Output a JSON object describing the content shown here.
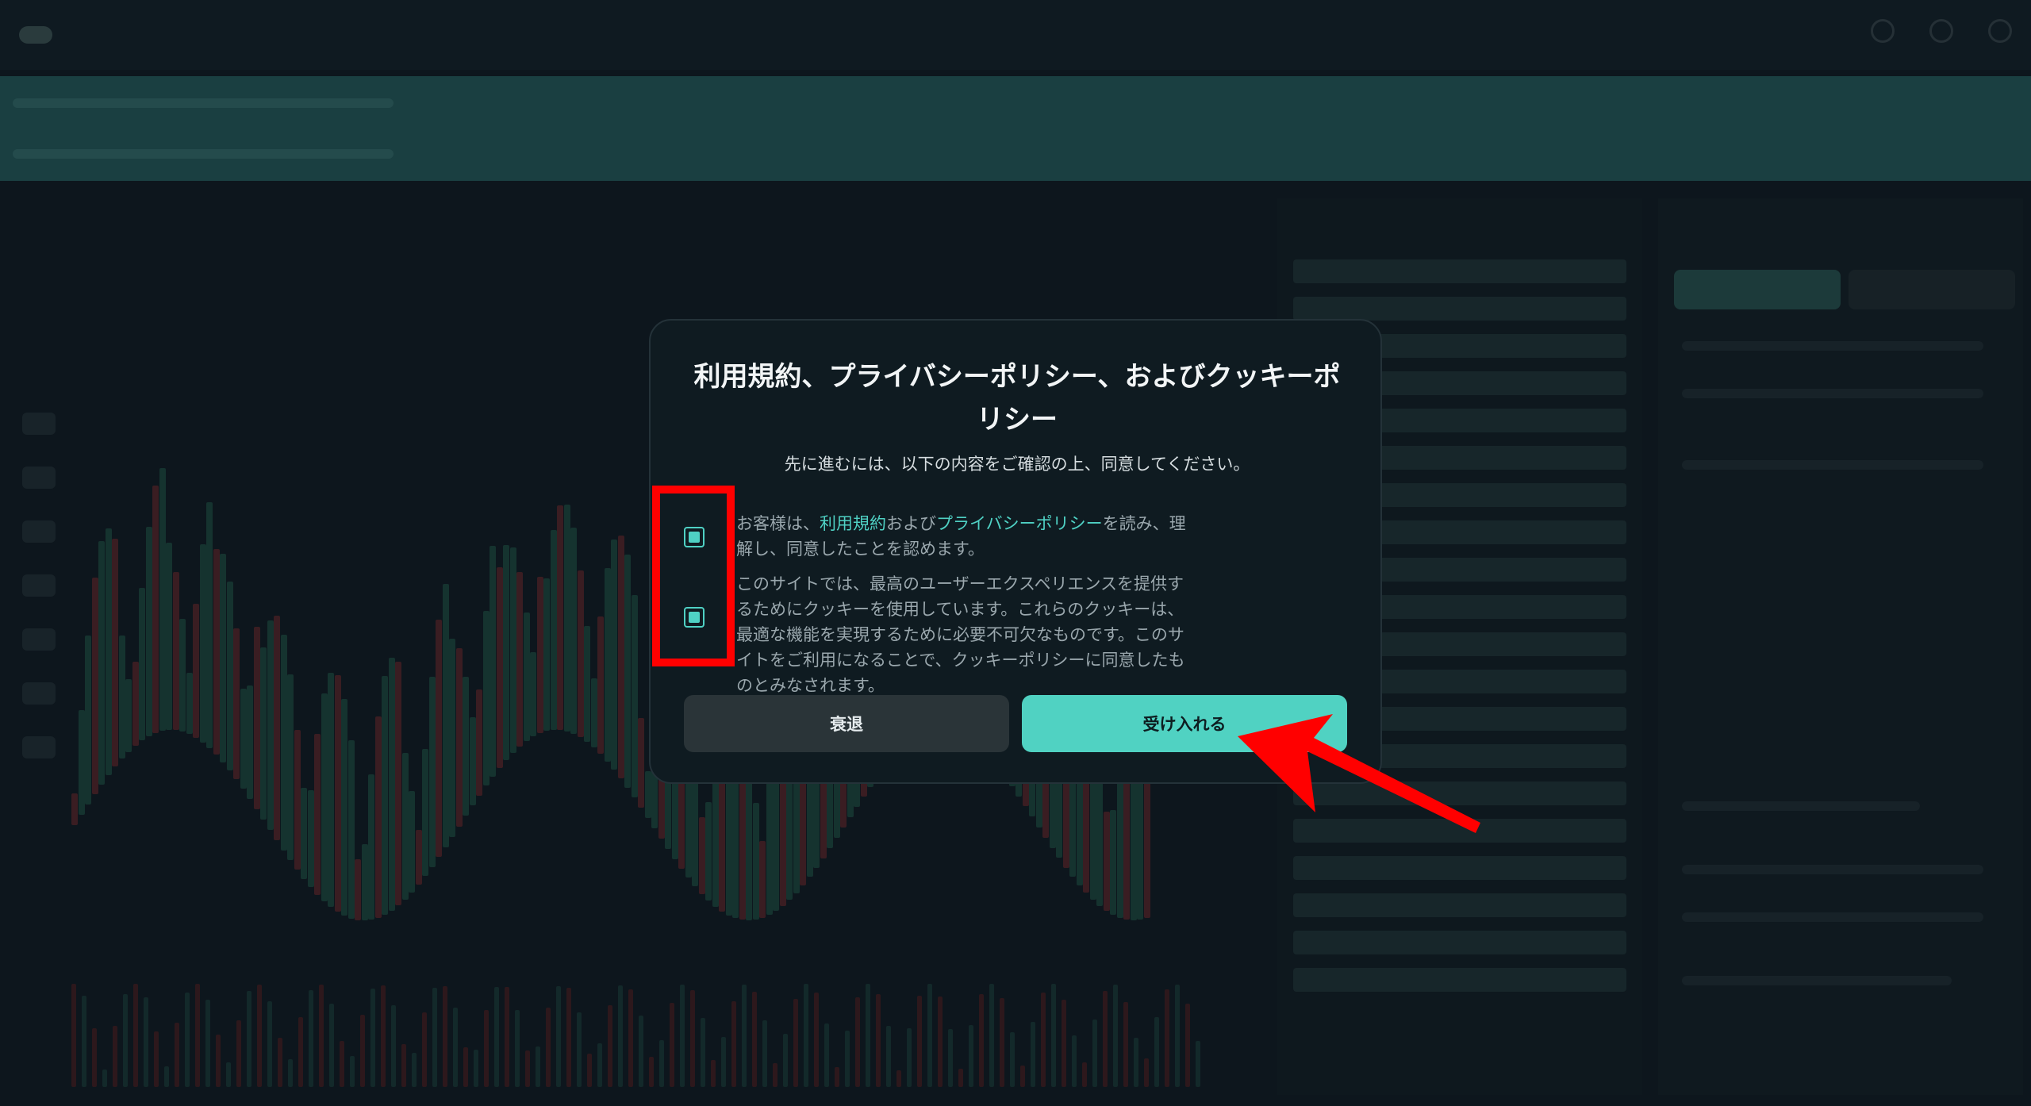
{
  "modal": {
    "title": "利用規約、プライバシーポリシー、およびクッキーポリシー",
    "subtitle": "先に進むには、以下の内容をご確認の上、同意してください。",
    "consent_terms": {
      "prefix": "お客様は、",
      "terms_link": "利用規約",
      "connector": "および",
      "privacy_link": "プライバシーポリシー",
      "suffix": "を読み、理解し、同意したことを認めます。"
    },
    "consent_cookies": {
      "text": "このサイトでは、最高のユーザーエクスペリエンスを提供するためにクッキーを使用しています。これらのクッキーは、最適な機能を実現するために必要不可欠なものです。このサイトをご利用になることで、クッキーポリシーに同意したものとみなされます。"
    },
    "decline_label": "衰退",
    "accept_label": "受け入れる"
  },
  "colors": {
    "accent": "#50d2c2",
    "link": "#4fd1c4",
    "annotation": "#ff0000",
    "modal_bg": "#0f1b21"
  },
  "icons": {
    "checkbox_terms": "checked-checkbox-icon",
    "checkbox_cookies": "checked-checkbox-icon",
    "annotation_arrow": "arrow-icon"
  }
}
